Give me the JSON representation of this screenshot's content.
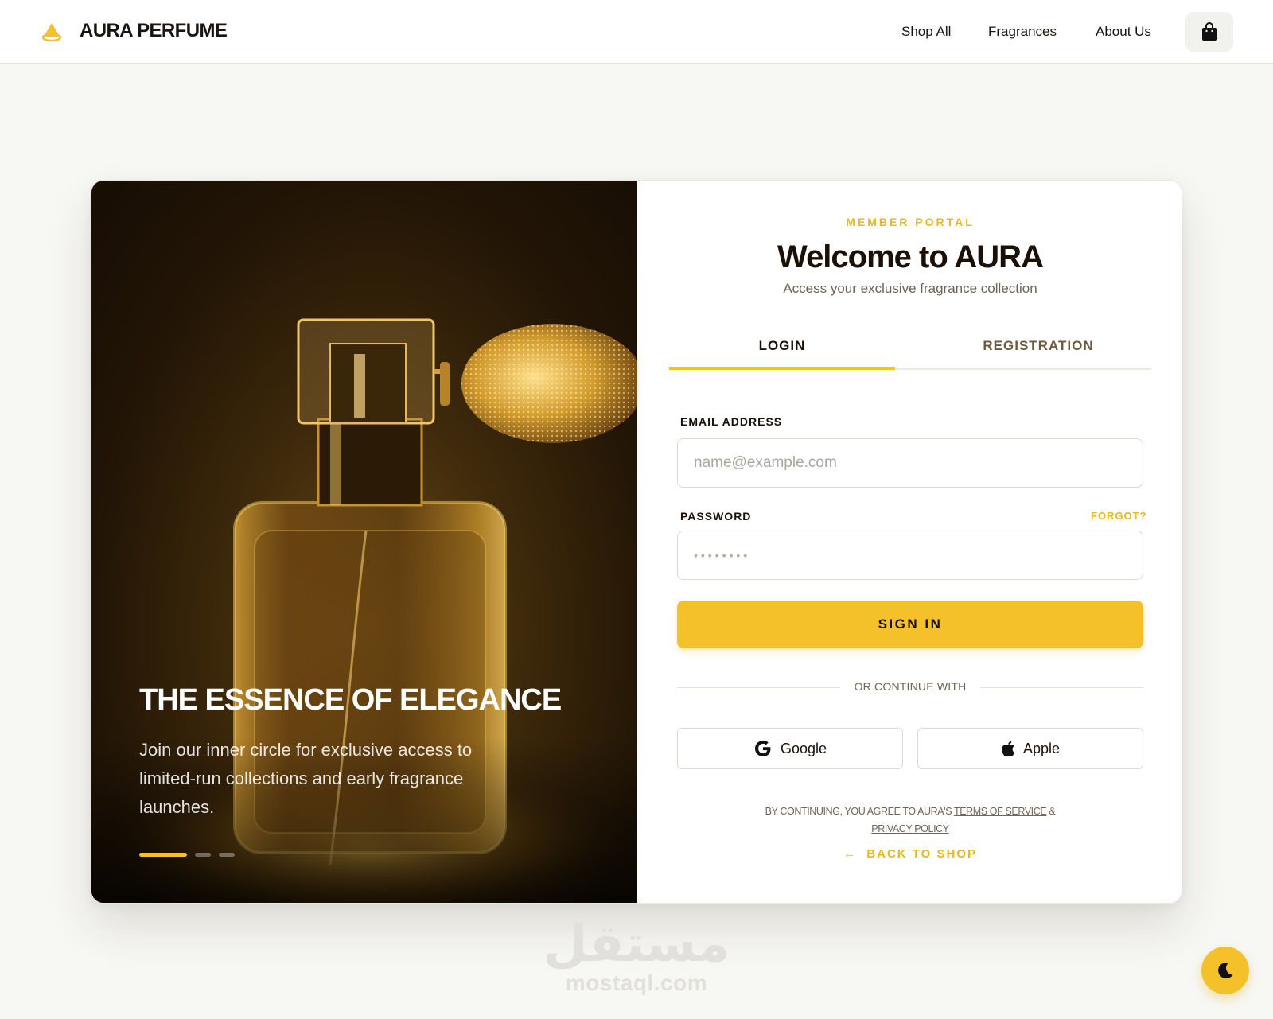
{
  "header": {
    "brand": "AURA PERFUME",
    "nav": [
      "Shop All",
      "Fragrances",
      "About Us"
    ],
    "cart_icon": "shopping-bag-icon"
  },
  "hero": {
    "title": "THE ESSENCE OF ELEGANCE",
    "text": "Join our inner circle for exclusive access to limited-run collections and early fragrance launches.",
    "slides_total": 3,
    "active_slide": 1
  },
  "form": {
    "eyebrow": "MEMBER PORTAL",
    "title": "Welcome to AURA",
    "subtitle": "Access your exclusive fragrance collection",
    "tabs": [
      {
        "label": "LOGIN",
        "active": true
      },
      {
        "label": "REGISTRATION",
        "active": false
      }
    ],
    "email_label": "EMAIL ADDRESS",
    "email_placeholder": "name@example.com",
    "password_label": "PASSWORD",
    "forgot": "FORGOT?",
    "password_placeholder": "••••••••",
    "signin": "SIGN IN",
    "divider": "OR CONTINUE WITH",
    "google": "Google",
    "apple": "Apple",
    "legal_prefix": "BY CONTINUING, YOU AGREE TO AURA'S ",
    "terms": "TERMS OF SERVICE",
    "legal_amp": " &",
    "privacy": "PRIVACY POLICY",
    "back": "BACK TO SHOP"
  },
  "watermark": {
    "arabic": "مستقل",
    "latin": "mostaql.com"
  },
  "colors": {
    "accent": "#f4c12a",
    "accent_text": "#e8b81d",
    "background": "#f7f7f4"
  },
  "theme_toggle_icon": "moon-icon"
}
